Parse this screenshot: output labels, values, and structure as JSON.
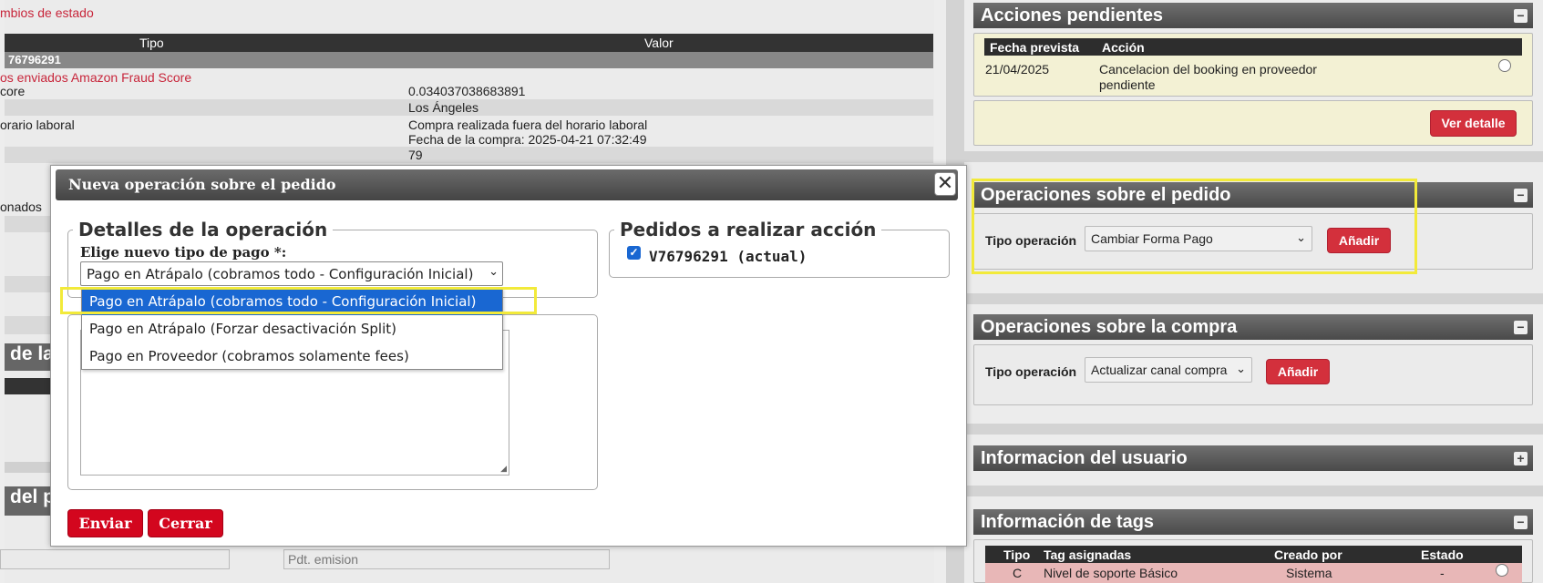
{
  "left": {
    "cambios_link": "mbios de estado",
    "table_headers": {
      "tipo": "Tipo",
      "valor": "Valor"
    },
    "order_bar": " 76796291",
    "fraud_link": "os enviados Amazon Fraud Score",
    "rows": [
      {
        "label": "core",
        "value": "0.034037038683891"
      },
      {
        "label": "",
        "value": "Los Ángeles"
      },
      {
        "label": "orario laboral",
        "value": "Compra realizada fuera del horario laboral"
      },
      {
        "label": "",
        "value": "Fecha de la compra: 2025-04-21 07:32:49"
      },
      {
        "label": "",
        "value": "79"
      }
    ],
    "onados_text": "onados",
    "section_de": "de la",
    "section_del": "del p",
    "pdt_emision_placeholder": "Pdt. emision"
  },
  "right": {
    "acciones": {
      "title": "Acciones pendientes",
      "toggle": "−",
      "headers": [
        "Fecha prevista",
        "Acción"
      ],
      "rows": [
        {
          "fecha": "21/04/2025",
          "accion_line1": "Cancelacion del booking en proveedor",
          "accion_line2": "pendiente"
        }
      ],
      "ver_detalle": "Ver detalle"
    },
    "op_pedido": {
      "title": "Operaciones sobre el pedido",
      "toggle": "−",
      "tipo_label": "Tipo operación",
      "selected": "Cambiar Forma Pago",
      "add": "Añadir"
    },
    "op_compra": {
      "title": "Operaciones sobre la compra",
      "toggle": "−",
      "tipo_label": "Tipo operación",
      "selected": "Actualizar canal compra",
      "add": "Añadir"
    },
    "info_usuario": {
      "title": "Informacion del usuario",
      "toggle": "+"
    },
    "info_tags": {
      "title": "Información de tags",
      "toggle": "−",
      "headers": [
        "Tipo",
        "Tag asignadas",
        "Creado por",
        "Estado"
      ],
      "rows": [
        {
          "tipo": "C",
          "tag": "Nivel de soporte Básico",
          "creado": "Sistema",
          "estado": "-"
        }
      ]
    }
  },
  "modal": {
    "title": "Nueva operación sobre el pedido",
    "close": "✕",
    "detalles_legend": "Detalles de la operación",
    "pago_label": "Elige nuevo tipo de pago *:",
    "pago_selected": "Pago en Atrápalo (cobramos todo - Configuración Inicial)",
    "options": [
      "Pago en Atrápalo (cobramos todo - Configuración Inicial)",
      "Pago en Atrápalo (Forzar desactivación Split)",
      "Pago en Proveedor (cobramos solamente fees)"
    ],
    "pedidos_legend": "Pedidos a realizar acción",
    "pedido_item": "V76796291 (actual)",
    "enviar": "Enviar",
    "cerrar": "Cerrar"
  }
}
